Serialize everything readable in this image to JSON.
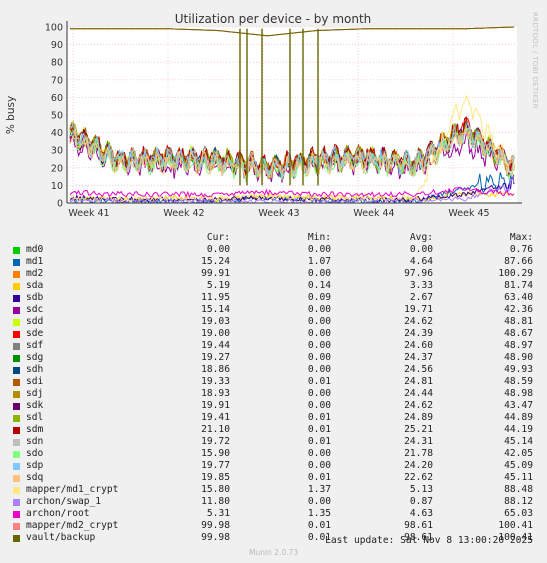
{
  "chart_data": {
    "type": "line",
    "title": "Utilization per device - by month",
    "ylabel": "% busy",
    "xlabel": "",
    "ylim": [
      0,
      100
    ],
    "yticks": [
      0,
      10,
      20,
      30,
      40,
      50,
      60,
      70,
      80,
      90,
      100
    ],
    "xticks": [
      "Week 41",
      "Week 42",
      "Week 43",
      "Week 44",
      "Week 45"
    ],
    "grid": true,
    "x": [
      "Week 41",
      "Week 41",
      "Week 42",
      "Week 42",
      "Week 43",
      "Week 43",
      "Week 44",
      "Week 44",
      "Week 45",
      "Week 45"
    ],
    "series": [
      {
        "name": "md0",
        "color": "#00cc00",
        "values": [
          0,
          0,
          0,
          0,
          0,
          0,
          0,
          0,
          0,
          0
        ]
      },
      {
        "name": "md1",
        "color": "#0066b3",
        "values": [
          2,
          1,
          1,
          1,
          3,
          2,
          1,
          1,
          8,
          15
        ]
      },
      {
        "name": "md2",
        "color": "#ff8000",
        "values": [
          99,
          99,
          99,
          98,
          95,
          98,
          99,
          99,
          99,
          100
        ]
      },
      {
        "name": "sda",
        "color": "#ffcc00",
        "values": [
          3,
          2,
          3,
          2,
          4,
          3,
          3,
          2,
          5,
          5
        ]
      },
      {
        "name": "sdb",
        "color": "#330099",
        "values": [
          3,
          2,
          2,
          2,
          3,
          2,
          2,
          2,
          5,
          12
        ]
      },
      {
        "name": "sdc",
        "color": "#990099",
        "values": [
          34,
          22,
          21,
          22,
          18,
          20,
          22,
          19,
          33,
          20
        ]
      },
      {
        "name": "sdd",
        "color": "#ccff00",
        "values": [
          42,
          24,
          26,
          25,
          20,
          25,
          27,
          22,
          44,
          20
        ]
      },
      {
        "name": "sde",
        "color": "#ff0000",
        "values": [
          40,
          24,
          26,
          24,
          20,
          24,
          26,
          22,
          43,
          20
        ]
      },
      {
        "name": "sdf",
        "color": "#808080",
        "values": [
          40,
          24,
          26,
          25,
          20,
          25,
          26,
          22,
          43,
          20
        ]
      },
      {
        "name": "sdg",
        "color": "#008f00",
        "values": [
          40,
          24,
          25,
          24,
          20,
          24,
          26,
          22,
          42,
          20
        ]
      },
      {
        "name": "sdh",
        "color": "#00487d",
        "values": [
          40,
          24,
          25,
          25,
          20,
          24,
          26,
          22,
          42,
          19
        ]
      },
      {
        "name": "sdi",
        "color": "#b35a00",
        "values": [
          41,
          25,
          26,
          25,
          21,
          25,
          27,
          22,
          44,
          20
        ]
      },
      {
        "name": "sdj",
        "color": "#b38f00",
        "values": [
          40,
          24,
          25,
          24,
          20,
          24,
          26,
          22,
          42,
          19
        ]
      },
      {
        "name": "sdk",
        "color": "#6b006b",
        "values": [
          40,
          24,
          25,
          24,
          20,
          24,
          26,
          22,
          42,
          20
        ]
      },
      {
        "name": "sdl",
        "color": "#8fb300",
        "values": [
          41,
          25,
          26,
          25,
          21,
          25,
          27,
          23,
          43,
          20
        ]
      },
      {
        "name": "sdm",
        "color": "#b30000",
        "values": [
          41,
          26,
          27,
          26,
          21,
          26,
          28,
          23,
          44,
          22
        ]
      },
      {
        "name": "sdn",
        "color": "#bebebe",
        "values": [
          40,
          24,
          25,
          24,
          20,
          24,
          26,
          22,
          42,
          20
        ]
      },
      {
        "name": "sdo",
        "color": "#80ff80",
        "values": [
          38,
          21,
          22,
          21,
          18,
          21,
          23,
          19,
          40,
          16
        ]
      },
      {
        "name": "sdp",
        "color": "#80c9ff",
        "values": [
          40,
          24,
          25,
          24,
          20,
          24,
          26,
          22,
          42,
          20
        ]
      },
      {
        "name": "sdq",
        "color": "#ffc080",
        "values": [
          38,
          22,
          23,
          22,
          18,
          22,
          24,
          20,
          40,
          20
        ]
      },
      {
        "name": "mapper/md1_crypt",
        "color": "#ffe680",
        "values": [
          3,
          2,
          3,
          3,
          4,
          3,
          3,
          3,
          60,
          16
        ]
      },
      {
        "name": "archon/swap_1",
        "color": "#aa80ff",
        "values": [
          1,
          1,
          1,
          1,
          1,
          1,
          1,
          1,
          2,
          12
        ]
      },
      {
        "name": "archon/root",
        "color": "#ee00cc",
        "values": [
          6,
          5,
          5,
          5,
          6,
          5,
          5,
          5,
          8,
          5
        ]
      },
      {
        "name": "mapper/md2_crypt",
        "color": "#ff8080",
        "values": [
          99,
          99,
          99,
          98,
          95,
          98,
          99,
          99,
          99,
          100
        ]
      },
      {
        "name": "vault/backup",
        "color": "#666600",
        "values": [
          99,
          99,
          99,
          98,
          95,
          98,
          99,
          99,
          99,
          100
        ]
      }
    ]
  },
  "legend": {
    "headers": {
      "cur": "Cur:",
      "min": "Min:",
      "avg": "Avg:",
      "max": "Max:"
    },
    "rows": [
      {
        "name": "md0",
        "color": "#00cc00",
        "cur": "0.00",
        "min": "0.00",
        "avg": "0.00",
        "max": "0.76"
      },
      {
        "name": "md1",
        "color": "#0066b3",
        "cur": "15.24",
        "min": "1.07",
        "avg": "4.64",
        "max": "87.66"
      },
      {
        "name": "md2",
        "color": "#ff8000",
        "cur": "99.91",
        "min": "0.00",
        "avg": "97.96",
        "max": "100.29"
      },
      {
        "name": "sda",
        "color": "#ffcc00",
        "cur": "5.19",
        "min": "0.14",
        "avg": "3.33",
        "max": "81.74"
      },
      {
        "name": "sdb",
        "color": "#330099",
        "cur": "11.95",
        "min": "0.09",
        "avg": "2.67",
        "max": "63.40"
      },
      {
        "name": "sdc",
        "color": "#990099",
        "cur": "15.14",
        "min": "0.00",
        "avg": "19.71",
        "max": "42.36"
      },
      {
        "name": "sdd",
        "color": "#ccff00",
        "cur": "19.03",
        "min": "0.00",
        "avg": "24.62",
        "max": "48.81"
      },
      {
        "name": "sde",
        "color": "#ff0000",
        "cur": "19.00",
        "min": "0.00",
        "avg": "24.39",
        "max": "48.67"
      },
      {
        "name": "sdf",
        "color": "#808080",
        "cur": "19.44",
        "min": "0.00",
        "avg": "24.60",
        "max": "48.97"
      },
      {
        "name": "sdg",
        "color": "#008f00",
        "cur": "19.27",
        "min": "0.00",
        "avg": "24.37",
        "max": "48.90"
      },
      {
        "name": "sdh",
        "color": "#00487d",
        "cur": "18.86",
        "min": "0.00",
        "avg": "24.56",
        "max": "49.93"
      },
      {
        "name": "sdi",
        "color": "#b35a00",
        "cur": "19.33",
        "min": "0.01",
        "avg": "24.81",
        "max": "48.59"
      },
      {
        "name": "sdj",
        "color": "#b38f00",
        "cur": "18.93",
        "min": "0.00",
        "avg": "24.44",
        "max": "48.98"
      },
      {
        "name": "sdk",
        "color": "#6b006b",
        "cur": "19.91",
        "min": "0.00",
        "avg": "24.62",
        "max": "43.47"
      },
      {
        "name": "sdl",
        "color": "#8fb300",
        "cur": "19.41",
        "min": "0.01",
        "avg": "24.89",
        "max": "44.89"
      },
      {
        "name": "sdm",
        "color": "#b30000",
        "cur": "21.10",
        "min": "0.01",
        "avg": "25.21",
        "max": "44.19"
      },
      {
        "name": "sdn",
        "color": "#bebebe",
        "cur": "19.72",
        "min": "0.01",
        "avg": "24.31",
        "max": "45.14"
      },
      {
        "name": "sdo",
        "color": "#80ff80",
        "cur": "15.90",
        "min": "0.00",
        "avg": "21.78",
        "max": "42.05"
      },
      {
        "name": "sdp",
        "color": "#80c9ff",
        "cur": "19.77",
        "min": "0.00",
        "avg": "24.20",
        "max": "45.09"
      },
      {
        "name": "sdq",
        "color": "#ffc080",
        "cur": "19.85",
        "min": "0.01",
        "avg": "22.62",
        "max": "45.11"
      },
      {
        "name": "mapper/md1_crypt",
        "color": "#ffe680",
        "cur": "15.80",
        "min": "1.37",
        "avg": "5.13",
        "max": "88.48"
      },
      {
        "name": "archon/swap_1",
        "color": "#aa80ff",
        "cur": "11.80",
        "min": "0.00",
        "avg": "0.87",
        "max": "88.12"
      },
      {
        "name": "archon/root",
        "color": "#ee00cc",
        "cur": "5.31",
        "min": "1.35",
        "avg": "4.63",
        "max": "65.03"
      },
      {
        "name": "mapper/md2_crypt",
        "color": "#ff8080",
        "cur": "99.98",
        "min": "0.01",
        "avg": "98.61",
        "max": "100.41"
      },
      {
        "name": "vault/backup",
        "color": "#666600",
        "cur": "99.98",
        "min": "0.01",
        "avg": "98.61",
        "max": "100.41"
      }
    ]
  },
  "footer": {
    "last_update": "Last update: Sat Nov  8 13:00:20 2025",
    "version": "Munin 2.0.73"
  },
  "sidebar_text": "RRDTOOL / TOBI OETIKER"
}
